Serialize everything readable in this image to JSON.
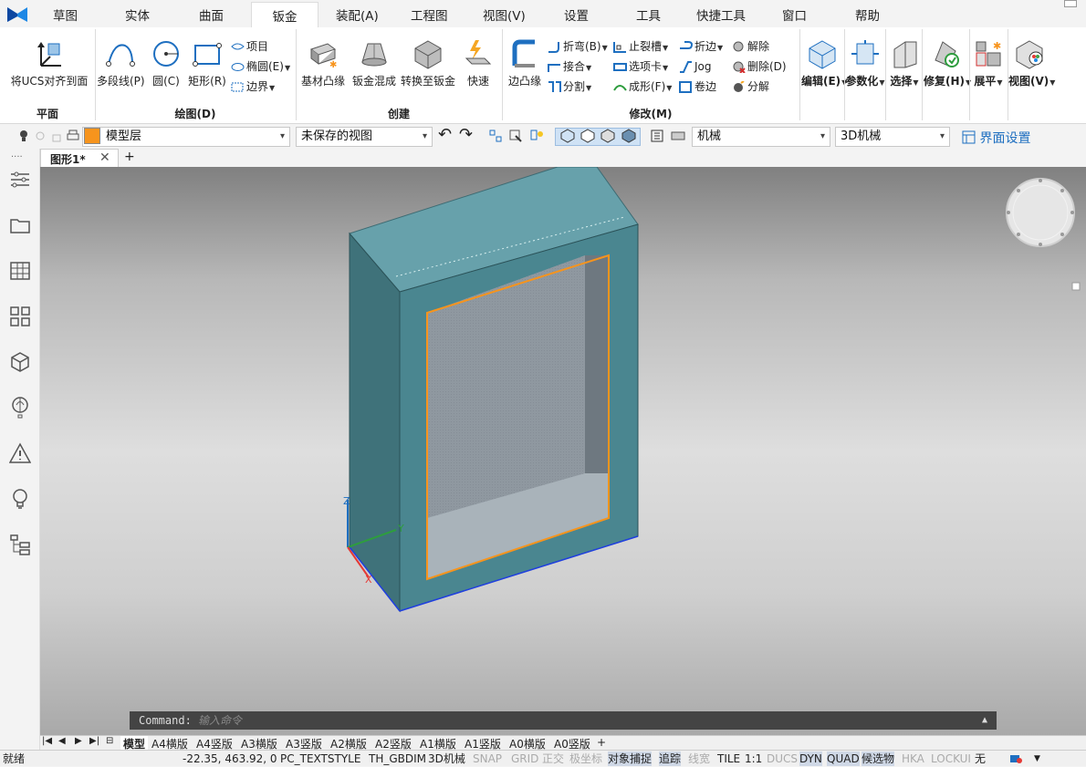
{
  "menu": {
    "items": [
      "草图",
      "实体",
      "曲面",
      "钣金",
      "装配(A)",
      "工程图",
      "视图(V)",
      "设置",
      "工具",
      "快捷工具",
      "窗口",
      "帮助"
    ],
    "active": "钣金"
  },
  "ribbon": {
    "plane": {
      "label": "平面",
      "align_ucs": "将UCS对齐到面"
    },
    "draw": {
      "label": "绘图(D)",
      "polyline": "多段线(P)",
      "circle": "圆(C)",
      "rect": "矩形(R)",
      "item": "项目",
      "ellipse": "椭圆(E)",
      "boundary": "边界"
    },
    "create": {
      "label": "创建",
      "base_flange": "基材凸缘",
      "lofted": "钣金混成",
      "convert": "转换至钣金",
      "quick": "快速"
    },
    "modify": {
      "label": "修改(M)",
      "edge_flange": "边凸缘",
      "bend": "折弯(B)",
      "join": "接合",
      "split": "分割",
      "relief": "止裂槽",
      "tab": "选项卡",
      "form": "成形(F)",
      "hem": "折边",
      "jog": "Jog",
      "roll": "卷边",
      "unlock": "解除",
      "delete": "删除(D)",
      "dissolve": "分解"
    },
    "edit": "编辑(E)",
    "param": "参数化",
    "select": "选择",
    "repair": "修复(H)",
    "unfold": "展平",
    "view": "视图(V)"
  },
  "propbar": {
    "layer": "模型层",
    "layer_color": "#f7941d",
    "saved_view": "未保存的视图",
    "visual_style": "机械",
    "workspace": "3D机械",
    "ui_settings": "界面设置"
  },
  "doc_tab": "图形1*",
  "add_tab": "+",
  "axes": {
    "x": "X",
    "y": "Y",
    "z": "Z"
  },
  "command": {
    "prompt": "Command:",
    "placeholder": "输入命令"
  },
  "layout_tabs": [
    "模型",
    "A4横版",
    "A4竖版",
    "A3横版",
    "A3竖版",
    "A2横版",
    "A2竖版",
    "A1横版",
    "A1竖版",
    "A0横版",
    "A0竖版",
    "+"
  ],
  "status": {
    "ready": "就绪",
    "coords": "-22.35, 463.92, 0",
    "textstyle": "PC_TEXTSTYLE",
    "dimstyle": "TH_GBDIM",
    "workspace": "3D机械",
    "toggles": [
      {
        "label": "SNAP",
        "state": "off"
      },
      {
        "label": "GRID",
        "state": "off"
      },
      {
        "label": "正交",
        "state": "off"
      },
      {
        "label": "极坐标",
        "state": "off"
      },
      {
        "label": "对象捕捉",
        "state": "on"
      },
      {
        "label": "追踪",
        "state": "on"
      },
      {
        "label": "线宽",
        "state": "off"
      },
      {
        "label": "TILE",
        "state": "normal"
      },
      {
        "label": "1:1",
        "state": "normal"
      },
      {
        "label": "DUCS",
        "state": "off"
      },
      {
        "label": "DYN",
        "state": "on"
      },
      {
        "label": "QUAD",
        "state": "on"
      },
      {
        "label": "候选物",
        "state": "on"
      },
      {
        "label": "HKA",
        "state": "off"
      },
      {
        "label": "LOCKUI",
        "state": "off"
      },
      {
        "label": "无",
        "state": "normal"
      }
    ]
  },
  "colors": {
    "accent": "#1e6fc0",
    "body_face": "#4c8a94",
    "top_face": "#6aa3ac",
    "edge_highlight": "#f7941d"
  }
}
